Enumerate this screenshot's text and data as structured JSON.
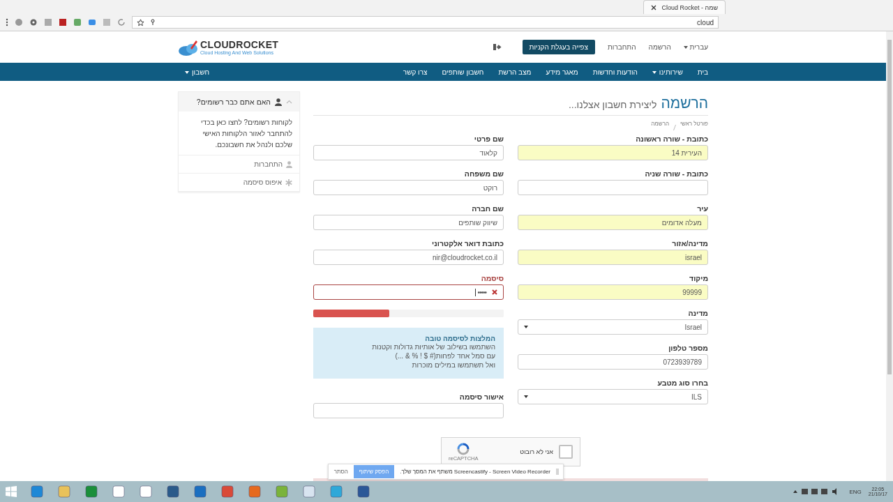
{
  "browser": {
    "tab_title": "Cloud Rocket - שמה",
    "address": "cloud"
  },
  "header": {
    "logo": "CLOUDROCKET",
    "logo_tagline": "Cloud Hosting And Web Solutions",
    "cart_button": "צפייה בעגלת הקניות",
    "links": [
      "הרשמה",
      "התחברות"
    ],
    "language": "עברית"
  },
  "nav": {
    "items": [
      {
        "label": "בית",
        "dropdown": false
      },
      {
        "label": "שירותינו",
        "dropdown": true
      },
      {
        "label": "הודעות וחדשות",
        "dropdown": false
      },
      {
        "label": "מאגר מידע",
        "dropdown": false
      },
      {
        "label": "מצב הרשת",
        "dropdown": false
      },
      {
        "label": "חשבון שותפים",
        "dropdown": false
      },
      {
        "label": "צרו קשר",
        "dropdown": false
      }
    ],
    "account": {
      "label": "חשבון",
      "dropdown": true
    }
  },
  "sidebar": {
    "title": "האם אתם כבר רשומים?",
    "text": "לקוחות רשומים? לחצו כאן בכדי להתחבר לאזור הלקוחות האישי שלכם ולנהל את חשבונכם.",
    "links": [
      {
        "label": "התחברות",
        "kind": "user"
      },
      {
        "label": "איפוס סיסמה",
        "kind": "asterisk"
      }
    ]
  },
  "page": {
    "title": "הרשמה",
    "subtitle": "ליצירת חשבון אצלנו...",
    "breadcrumb": [
      "פורטל ראשי",
      "הרשמה"
    ]
  },
  "form": {
    "right_fields": [
      {
        "label": "כתובת - שורה ראשונה",
        "value": "העירית 14",
        "kind": "text",
        "autofilled": true
      },
      {
        "label": "כתובת - שורה שניה",
        "kind": "text",
        "autofilled": false
      },
      {
        "label": "עיר",
        "value": "מעלה אדומים",
        "kind": "text",
        "autofilled": true
      },
      {
        "label": "מדינה/אזור",
        "value": "israel",
        "kind": "text",
        "autofilled": true
      },
      {
        "label": "מיקוד",
        "value": "99999",
        "kind": "text",
        "autofilled": true
      },
      {
        "label": "מדינה",
        "value": "Israel",
        "kind": "select",
        "autofilled": false
      },
      {
        "label": "מספר טלפון",
        "value": "0723939789",
        "kind": "text",
        "autofilled": false
      },
      {
        "label": "בחרו סוג מטבע",
        "value": "ILS",
        "kind": "select",
        "autofilled": false
      }
    ],
    "left_fields": [
      {
        "label": "שם פרטי",
        "value": "קלאוד",
        "kind": "text",
        "invalid": false
      },
      {
        "label": "שם משפחה",
        "value": "רוקט",
        "kind": "text",
        "invalid": false
      },
      {
        "label": "שם חברה",
        "value": "שיווק שותפים",
        "kind": "text",
        "invalid": false
      },
      {
        "label": "כתובת דואר אלקטרוני",
        "value": "nir@cloudrocket.co.il",
        "kind": "text",
        "invalid": false
      },
      {
        "label": "סיסמה",
        "value": "•••••",
        "kind": "password",
        "invalid": true
      }
    ],
    "password_strength": {
      "level": 0.4
    },
    "tips": {
      "title": "המלצות לסיסמה טובה",
      "lines": [
        "השתמשו בשילוב של אותיות גדולות וקטנות",
        "עם סמל אחד לפחות(# $ ! % & ...)",
        "ואל תשתמשו במילים מוכרות"
      ]
    },
    "confirm_field": {
      "label": "אישור סיסמה",
      "invalid": false
    },
    "captcha": {
      "label": "אני לא רובוט",
      "brand": "reCAPTCHA",
      "checked": false
    }
  },
  "share_bar": {
    "text": "Screencastify - Screen Video Recorder משתף את המסך שלך.",
    "stop_button": "הפסק שיתוף",
    "hide_link": "הסתר"
  },
  "taskbar": {
    "language": "ENG",
    "time": "22:05",
    "date": "21/10/17"
  }
}
